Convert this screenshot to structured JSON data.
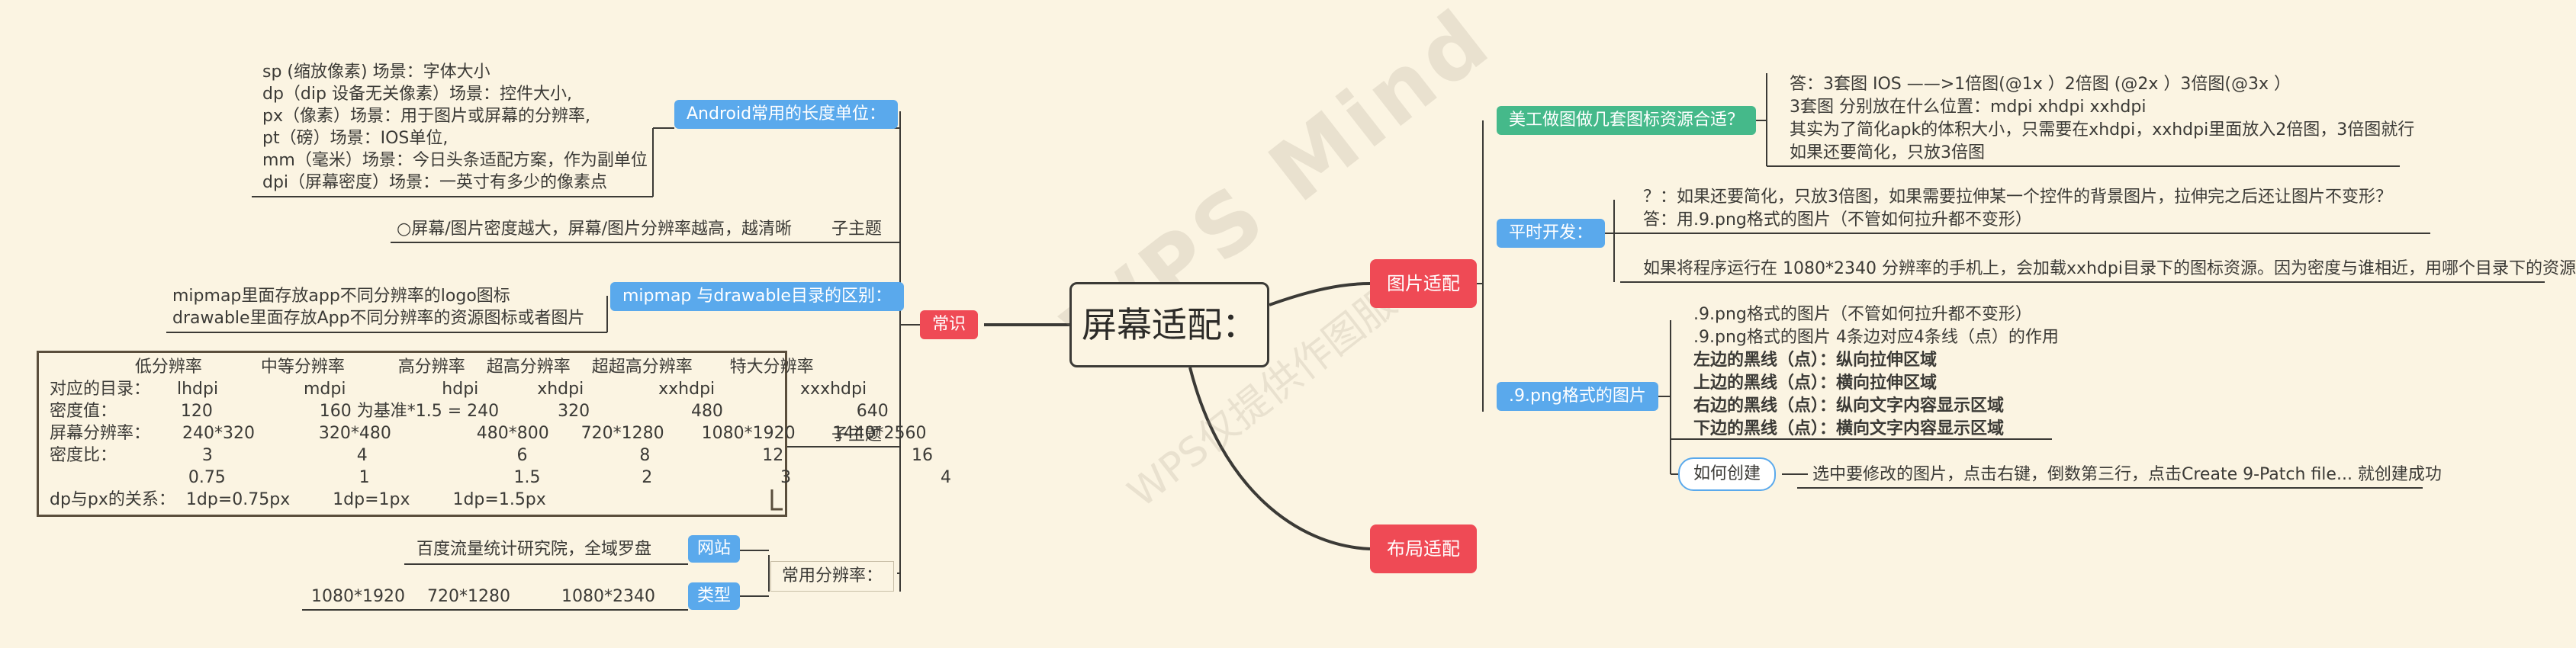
{
  "center": "屏幕适配：",
  "branches": {
    "changshi": "常识",
    "tupian": "图片适配",
    "buju": "布局适配"
  },
  "left": {
    "length_units": {
      "title": "Android常用的长度单位：",
      "lines": [
        "sp (缩放像素) 场景：字体大小",
        "dp（dip 设备无关像素）场景：控件大小,",
        "px（像素）场景：用于图片或屏幕的分辨率,",
        "pt（磅）场景：IOS单位,",
        "mm（毫米）场景：今日头条适配方案，作为副单位",
        "dpi（屏幕密度）场景：一英寸有多少的像素点"
      ]
    },
    "density_note": "○屏幕/图片密度越大，屏幕/图片分辨率越高，越清晰",
    "subtopic_label": "子主题",
    "mipmap": {
      "title": "mipmap 与drawable目录的区别：",
      "lines": [
        "mipmap里面存放app不同分辨率的logo图标",
        "drawable里面存放App不同分辨率的资源图标或者图片"
      ]
    },
    "table": {
      "lines": [
        "                低分辨率           中等分辨率          高分辨率    超高分辨率    超超高分辨率       特大分辨率",
        "对应的目录：     lhdpi                mdpi                  hdpi           xhdpi              xxhdpi                xxxhdpi",
        "密度值：            120                    160 为基准*1.5 = 240           320                   480                         640",
        "屏幕分辨率：      240*320            320*480                480*800      720*1280       1080*1920       1440*2560",
        "密度比：                3                           4                            6                     8                     12                        16",
        "                          0.75                         1                           1.5                   2                        3                            4",
        "dp与px的关系：  1dp=0.75px        1dp=1px        1dp=1.5px"
      ]
    },
    "common_res": {
      "title": "常用分辨率：",
      "website_label": "网站",
      "website_value": "百度流量统计研究院，全域罗盘",
      "type_label": "类型",
      "type_values": [
        "1080*1920",
        "720*1280",
        "1080*2340"
      ]
    }
  },
  "right": {
    "q1": {
      "title": "美工做图做几套图标资源合适？",
      "lines": [
        "答：3套图 IOS ——>1倍图(@1x ）2倍图 (@2x ）3倍图(@3x ）",
        "3套图 分别放在什么位置：mdpi            xhdpi              xxhdpi",
        "其实为了简化apk的体积大小，只需要在xhdpi，xxhdpi里面放入2倍图，3倍图就行",
        "如果还要简化，只放3倍图"
      ]
    },
    "dev": {
      "title": "平时开发：",
      "lines": [
        "？：如果还要简化，只放3倍图，如果需要拉伸某一个控件的背景图片，拉伸完之后还让图片不变形？",
        "答：用.9.png格式的图片（不管如何拉升都不变形）"
      ],
      "note": "如果将程序运行在 1080*2340 分辨率的手机上，会加载xxhdpi目录下的图标资源。因为密度与谁相近，用哪个目录下的资源"
    },
    "ninepatch": {
      "title": ".9.png格式的图片",
      "lines": [
        ".9.png格式的图片（不管如何拉升都不变形）",
        ".9.png格式的图片 4条边对应4条线（点）的作用"
      ],
      "bold_lines": [
        "左边的黑线（点）：纵向拉伸区域",
        "上边的黑线（点）：横向拉伸区域",
        "右边的黑线（点）：纵向文字内容显示区域",
        "下边的黑线（点）：横向文字内容显示区域"
      ],
      "create_label": "如何创建",
      "create_text": "选中要修改的图片，点击右键，倒数第三行，点击Create 9-Patch file... 就创建成功"
    }
  },
  "watermark": {
    "brand": "WPS Mind",
    "note": "WPS仅提供作图服务"
  },
  "colors": {
    "background": "#fbf4e2",
    "blue": "#5aa9ec",
    "green": "#45b98a",
    "red": "#ef4a55",
    "link": "#3b3a36"
  }
}
